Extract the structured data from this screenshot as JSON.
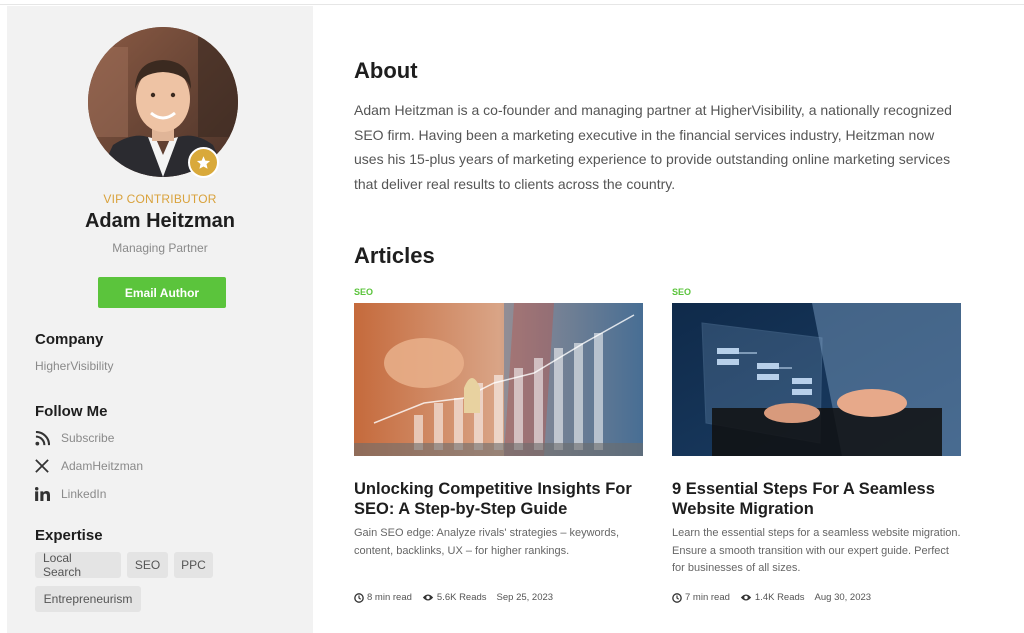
{
  "profile": {
    "badge": "VIP CONTRIBUTOR",
    "name": "Adam Heitzman",
    "role": "Managing Partner",
    "email_button": "Email Author",
    "company_heading": "Company",
    "company": "HigherVisibility",
    "follow_heading": "Follow Me",
    "social": [
      {
        "icon": "rss-icon",
        "label": "Subscribe"
      },
      {
        "icon": "x-icon",
        "label": "AdamHeitzman"
      },
      {
        "icon": "linkedin-icon",
        "label": "LinkedIn"
      }
    ],
    "expertise_heading": "Expertise",
    "expertise": [
      "Local Search",
      "SEO",
      "PPC",
      "Entrepreneurism"
    ]
  },
  "about": {
    "heading": "About",
    "text": "Adam Heitzman is a co-founder and managing partner at HigherVisibility, a nationally recognized SEO firm. Having been a marketing executive in the financial services industry, Heitzman now uses his 15-plus years of marketing experience to provide outstanding online marketing services that deliver real results to clients across the country."
  },
  "articles": {
    "heading": "Articles",
    "items": [
      {
        "category": "SEO",
        "title": "Unlocking Competitive Insights For SEO: A Step-by-Step Guide",
        "description": "Gain SEO edge: Analyze rivals' strategies – keywords, content, backlinks, UX – for higher rankings.",
        "read_time": "8 min read",
        "reads": "5.6K Reads",
        "date": "Sep 25, 2023"
      },
      {
        "category": "SEO",
        "title": "9 Essential Steps For A Seamless Website Migration",
        "description": "Learn the essential steps for a seamless website migration. Ensure a smooth transition with our expert guide. Perfect for businesses of all sizes.",
        "read_time": "7 min read",
        "reads": "1.4K Reads",
        "date": "Aug 30, 2023"
      }
    ]
  },
  "colors": {
    "accent_green": "#5bc43c",
    "vip_gold": "#d9a23c",
    "sidebar_bg": "#f2f2f2"
  }
}
